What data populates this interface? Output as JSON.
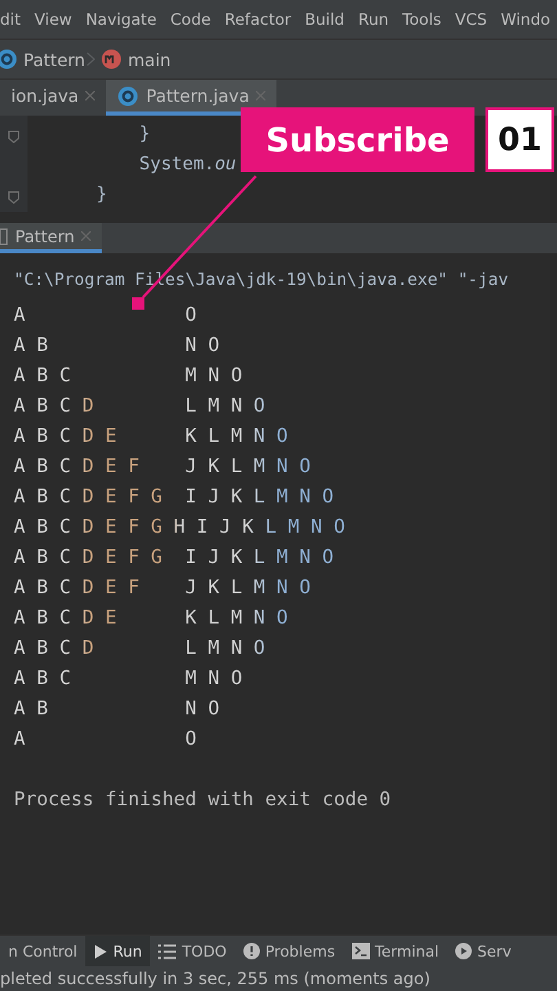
{
  "menu": [
    "dit",
    "View",
    "Navigate",
    "Code",
    "Refactor",
    "Build",
    "Run",
    "Tools",
    "VCS",
    "Windo"
  ],
  "breadcrumb": [
    {
      "label": "Pattern",
      "kind": "class"
    },
    {
      "label": "main",
      "kind": "method"
    }
  ],
  "editor_tabs": [
    {
      "label": "ion.java",
      "kind": "plain",
      "selected": false
    },
    {
      "label": "Pattern.java",
      "kind": "class",
      "selected": true
    }
  ],
  "editor_lines": [
    "    }",
    "    System.*ou*",
    "}"
  ],
  "run_tab": {
    "label": "Pattern",
    "selected": true
  },
  "console": {
    "command": "\"C:\\Program Files\\Java\\jdk-19\\bin\\java.exe\" \"-jav",
    "output": [
      "A              O",
      "A B            N O",
      "A B C          M N O",
      "A B C D        L M N O",
      "A B C D E      K L M N O",
      "A B C D E F    J K L M N O",
      "A B C D E F G  I J K L M N O",
      "A B C D E F G H I J K L M N O",
      "A B C D E F G  I J K L M N O",
      "A B C D E F    J K L M N O",
      "A B C D E      K L M N O",
      "A B C D        L M N O",
      "A B C          M N O",
      "A B            N O",
      "A              O"
    ],
    "exit": "Process finished with exit code 0"
  },
  "tool_windows": [
    {
      "label": "n Control",
      "kind": "none",
      "selected": false
    },
    {
      "label": "Run",
      "kind": "run",
      "selected": true
    },
    {
      "label": "TODO",
      "kind": "todo",
      "selected": false
    },
    {
      "label": "Problems",
      "kind": "problems",
      "selected": false
    },
    {
      "label": "Terminal",
      "kind": "terminal",
      "selected": false
    },
    {
      "label": "Serv",
      "kind": "services",
      "selected": false
    }
  ],
  "status": "pleted successfully in 3 sec, 255 ms (moments ago)",
  "promo": {
    "label": "Subscribe",
    "number": "01"
  }
}
